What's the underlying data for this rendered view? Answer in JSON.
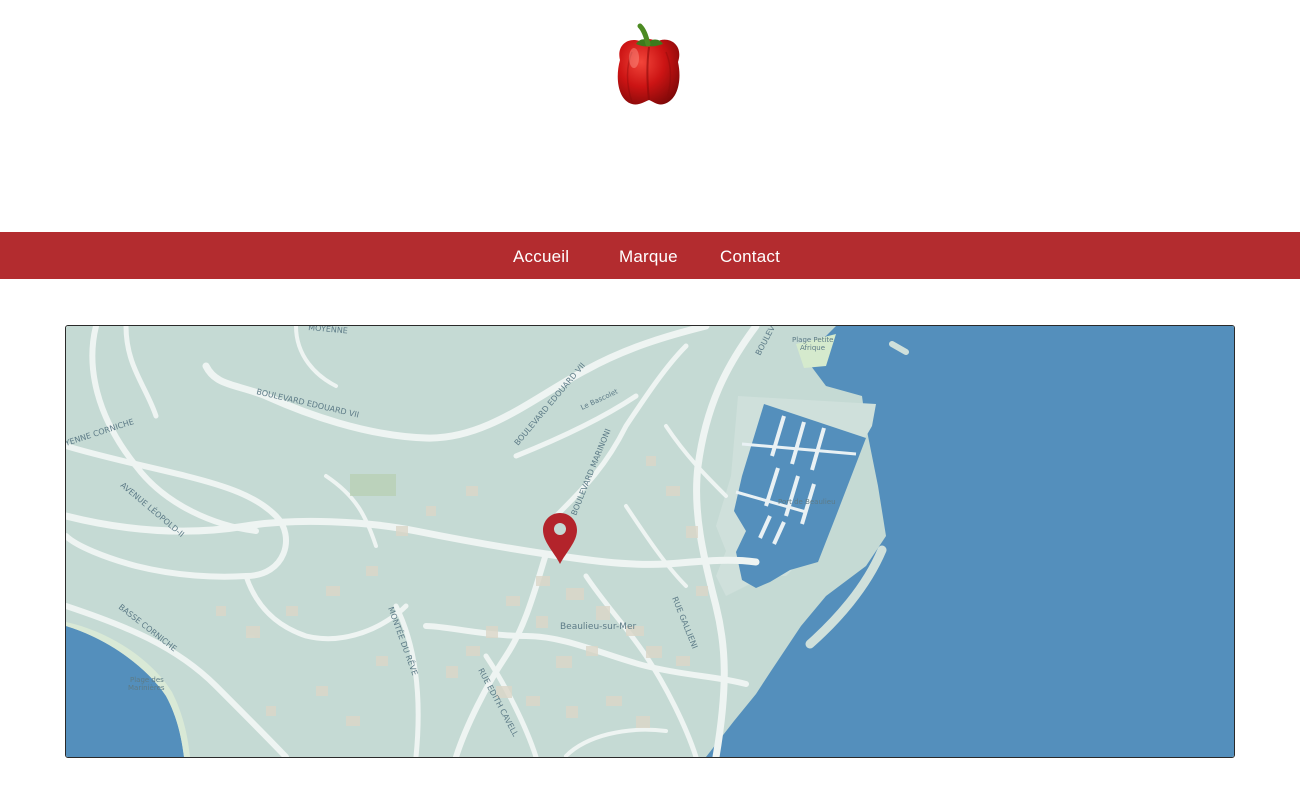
{
  "brand": {
    "logo_icon": "red-bell-pepper-icon"
  },
  "nav": {
    "items": [
      {
        "label": "Accueil"
      },
      {
        "label": "Marque"
      },
      {
        "label": "Contact"
      }
    ],
    "background": "#b32c2f",
    "text_color": "#ffffff"
  },
  "map": {
    "marker_icon": "map-pin-icon",
    "marker_color": "#b3242b",
    "land_color": "#c5dad4",
    "water_color": "#548fbc",
    "labels": {
      "moyenne": "MOYENNE",
      "boulevard_edouard_vii_a": "BOULEVARD EDOUARD VII",
      "boulevard_edouard_vii_b": "BOULEVARD EDOUARD VII",
      "corniche": "YENNE CORNICHE",
      "avenue_leopold": "AVENUE LÉOPOLD-II",
      "boulevard_marinoni": "BOULEVARD MARINONI",
      "basse_corniche": "BASSE CORNICHE",
      "montee_du_reve": "MONTÉE DU RÊVE",
      "rue_edith_cavell": "RUE EDITH CAVELL",
      "rue_gallieni": "RUE GALLIENI",
      "beaulieu": "Beaulieu-sur-Mer",
      "port": "Port de Beaulieu",
      "plage_petite_afrique_1": "Plage Petite",
      "plage_petite_afrique_2": "Afrique",
      "plage_des_fourmis_1": "Plage des",
      "plage_des_fourmis_2": "Marinières",
      "le_bascolet": "Le Bascolet",
      "boulevard_top": "BOULEV"
    }
  }
}
